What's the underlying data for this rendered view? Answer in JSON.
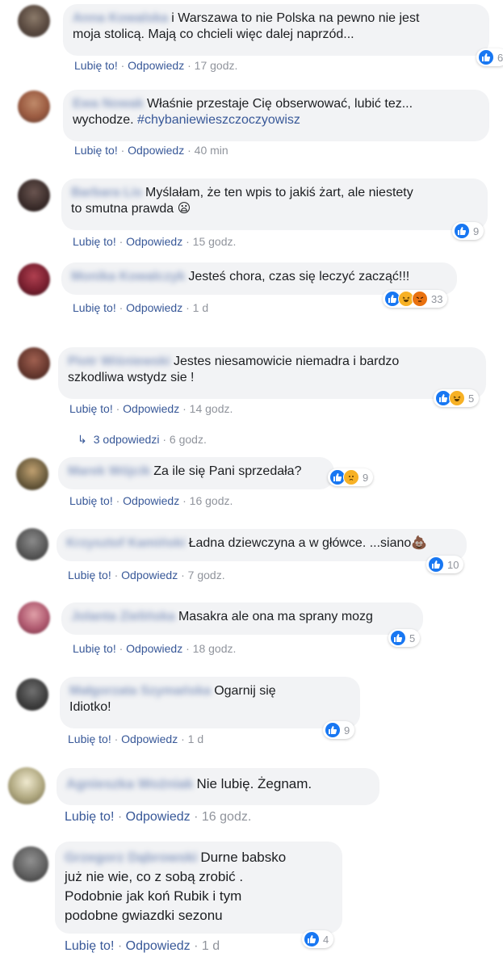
{
  "colors": {
    "link": "#385898",
    "meta": "#90949c",
    "bubble": "#f2f3f5",
    "like": "#1877f2"
  },
  "labels": {
    "like": "Lubię to!",
    "reply": "Odpowiedz",
    "sep": "·"
  },
  "comments": [
    {
      "author": "Anna Kowalska",
      "text": "i Warszawa to nie Polska na pewno nie jest\nmoja stolicą. Mają co chcieli więc dalej naprzód...",
      "time": "17 godz.",
      "reactions": {
        "icons": [
          "like-icon"
        ],
        "count": "6"
      }
    },
    {
      "author": "Ewa Nowak",
      "text": "Właśnie przestaje Cię obserwować, lubić tez...\nwychodze. ",
      "hashtag": "#chybaniewieszczoczyowisz",
      "time": "40 min"
    },
    {
      "author": "Barbara Lis",
      "text": "Myślałam, że ten wpis to jakiś żart, ale niestety\nto smutna prawda 😦",
      "time": "15 godz.",
      "reactions": {
        "icons": [
          "like-icon"
        ],
        "count": "9"
      }
    },
    {
      "author": "Monika Kowalczyk",
      "text": "Jesteś chora, czas się leczyć zacząć!!!",
      "time": "1 d",
      "reactions": {
        "icons": [
          "like-icon",
          "haha-icon",
          "angry-icon"
        ],
        "count": "33"
      }
    },
    {
      "author": "Piotr Wiśniewski",
      "text": "Jestes niesamowicie niemadra i bardzo\nszkodliwa wstydz sie !",
      "time": "14 godz.",
      "reactions": {
        "icons": [
          "like-icon",
          "haha-icon"
        ],
        "count": "5"
      },
      "replies": {
        "label": "3 odpowiedzi",
        "time": "6 godz."
      }
    },
    {
      "author": "Marek Wójcik",
      "text": "Za ile się Pani sprzedała?",
      "time": "16 godz.",
      "reactions": {
        "icons": [
          "like-icon",
          "sad-icon"
        ],
        "count": "9"
      }
    },
    {
      "author": "Krzysztof Kamiński",
      "text": "Ładna dziewczyna a w główce. ...siano💩",
      "time": "7 godz.",
      "reactions": {
        "icons": [
          "like-icon"
        ],
        "count": "10"
      }
    },
    {
      "author": "Jolanta Zielińska",
      "text": "Masakra ale ona ma sprany mozg",
      "time": "18 godz.",
      "reactions": {
        "icons": [
          "like-icon"
        ],
        "count": "5"
      }
    },
    {
      "author": "Małgorzata Szymańska",
      "text": "Ogarnij się\nIdiotko!",
      "time": "1 d",
      "reactions": {
        "icons": [
          "like-icon"
        ],
        "count": "9"
      }
    },
    {
      "author": "Agnieszka Woźniak",
      "text": "Nie lubię. Żegnam.",
      "time": "16 godz."
    },
    {
      "author": "Grzegorz Dąbrowski",
      "text": "Durne babsko\njuż nie wie, co z sobą zrobić .\nPodobnie jak koń Rubik i tym\npodobne gwiazdki sezonu",
      "time": "1 d",
      "reactions": {
        "icons": [
          "like-icon"
        ],
        "count": "4"
      }
    }
  ]
}
